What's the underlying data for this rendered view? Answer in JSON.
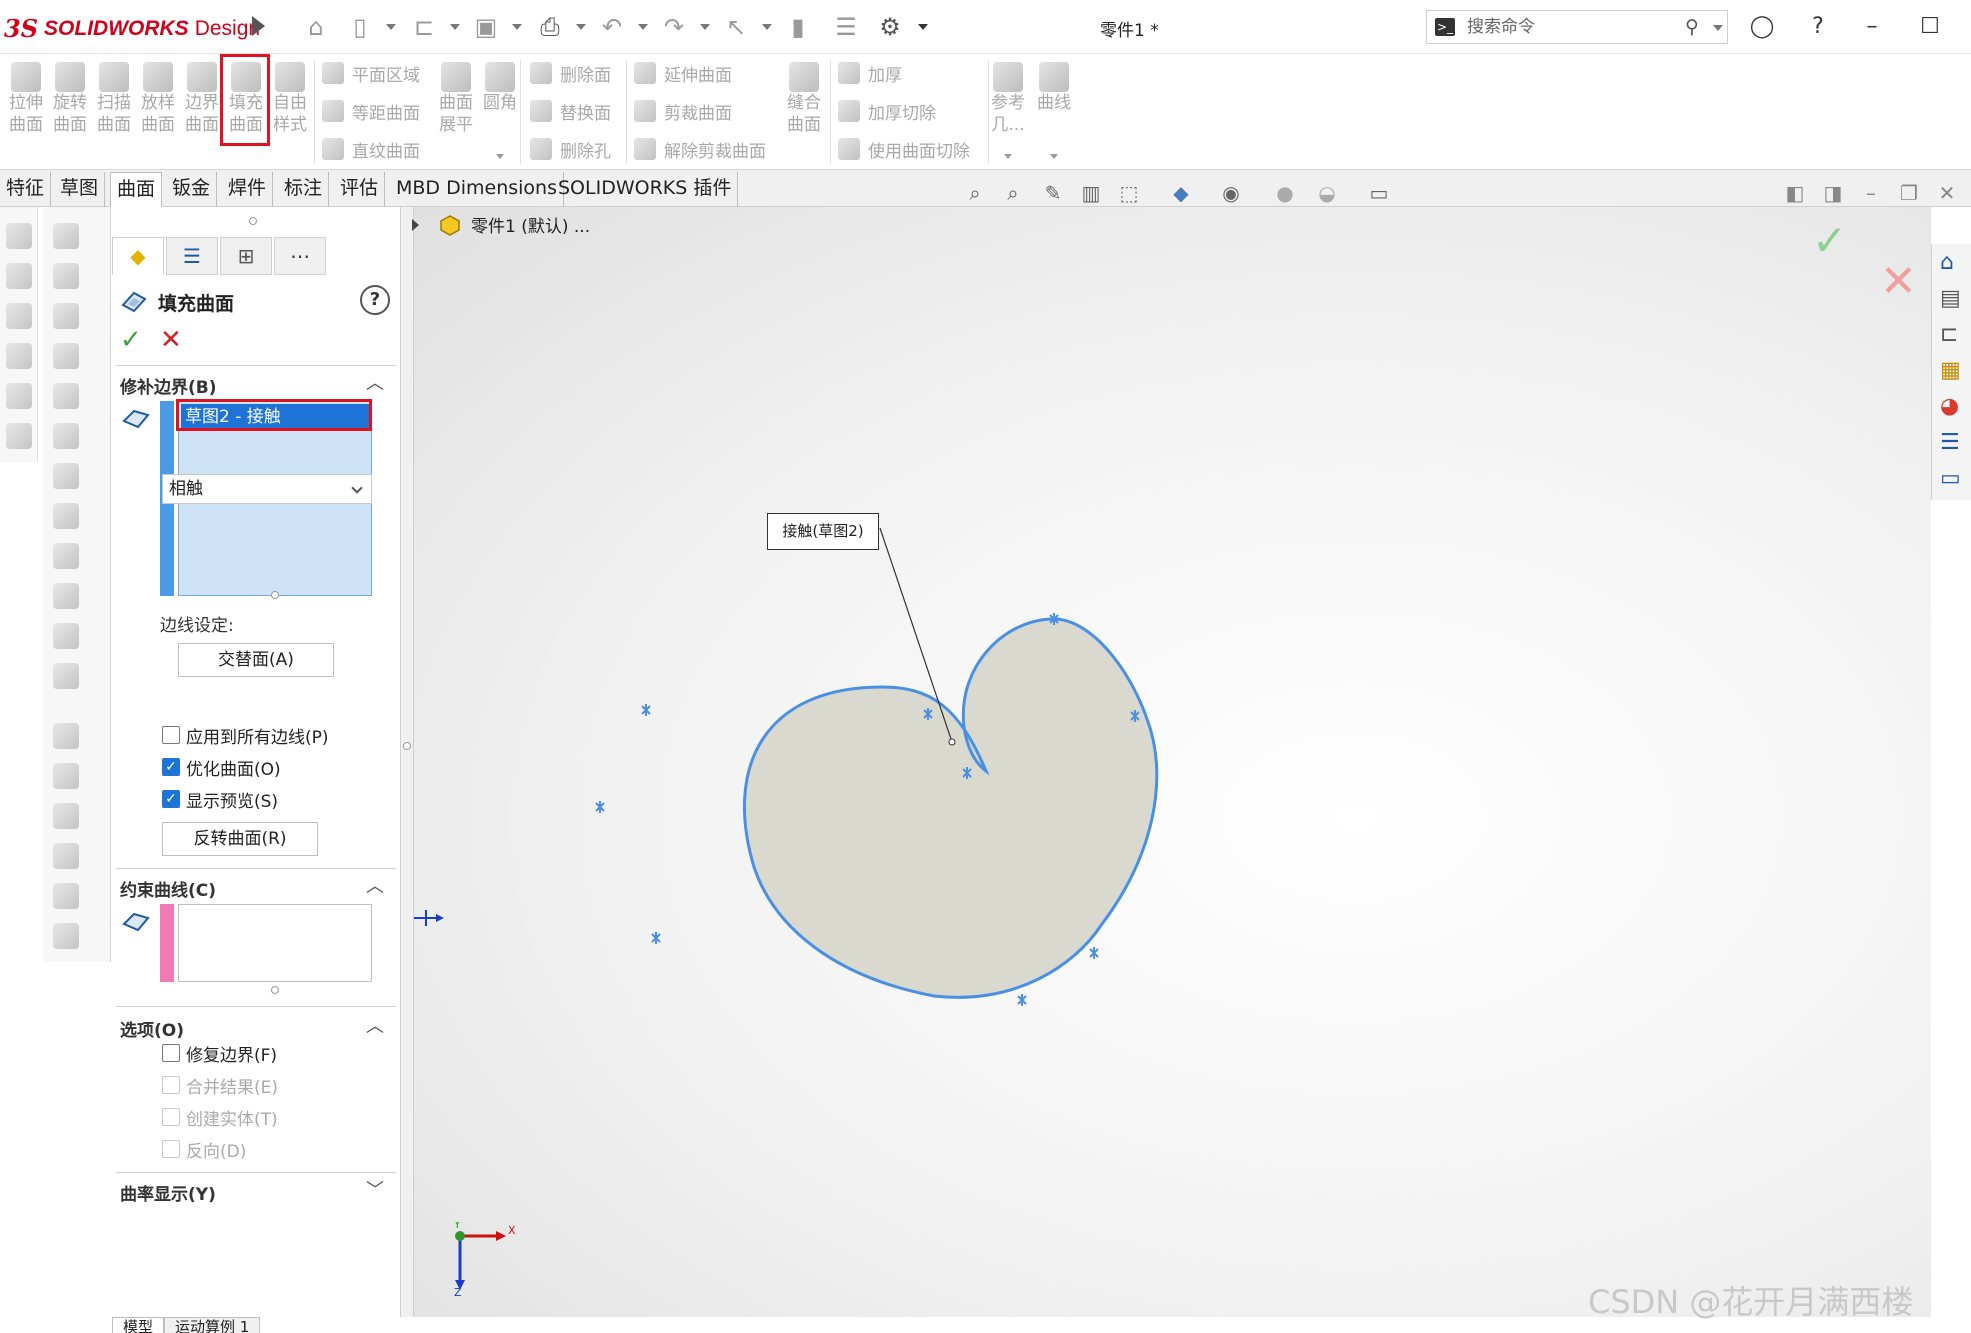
{
  "app": {
    "logo_mark": "3S",
    "logo_name": "SOLIDWORKS",
    "logo_sub": "Design",
    "document_title": "零件1 *",
    "search_placeholder": "搜索命令",
    "brand_color": "#d0021b"
  },
  "ribbon": {
    "big_buttons": [
      {
        "label": "拉伸\n曲面",
        "icon": "extruded-surface-icon"
      },
      {
        "label": "旋转\n曲面",
        "icon": "revolved-surface-icon"
      },
      {
        "label": "扫描\n曲面",
        "icon": "swept-surface-icon"
      },
      {
        "label": "放样\n曲面",
        "icon": "lofted-surface-icon"
      },
      {
        "label": "边界\n曲面",
        "icon": "boundary-surface-icon"
      },
      {
        "label": "填充\n曲面",
        "icon": "filled-surface-icon"
      },
      {
        "label": "自由\n样式",
        "icon": "freeform-icon"
      }
    ],
    "group2": [
      "平面区域",
      "等距曲面",
      "直纹曲面"
    ],
    "group2_big": [
      {
        "label": "曲面\n展平"
      },
      {
        "label": "圆角"
      }
    ],
    "group3": [
      "删除面",
      "替换面",
      "删除孔"
    ],
    "group4": [
      "延伸曲面",
      "剪裁曲面",
      "解除剪裁曲面"
    ],
    "group5_big": {
      "label": "缝合\n曲面"
    },
    "group6": [
      "加厚",
      "加厚切除",
      "使用曲面切除"
    ],
    "group7_big": [
      {
        "label": "参考\n几..."
      },
      {
        "label": "曲线"
      }
    ]
  },
  "tabs": [
    "特征",
    "草图",
    "曲面",
    "钣金",
    "焊件",
    "标注",
    "评估",
    "MBD Dimensions",
    "SOLIDWORKS 插件"
  ],
  "active_tab": "曲面",
  "breadcrumb": {
    "label": "零件1 (默认) ..."
  },
  "property_manager": {
    "title": "填充曲面",
    "help": "?",
    "sections": {
      "patch_boundary": {
        "title": "修补边界(B)",
        "selected_item": "草图2 - 接触",
        "edge_settings_label": "边线设定:",
        "alternate_face_button": "交替面(A)",
        "condition_value": "相触",
        "checkboxes": [
          {
            "label": "应用到所有边线(P)",
            "checked": false
          },
          {
            "label": "优化曲面(O)",
            "checked": true
          },
          {
            "label": "显示预览(S)",
            "checked": true
          }
        ],
        "reverse_surface_button": "反转曲面(R)"
      },
      "constraint_curves": {
        "title": "约束曲线(C)"
      },
      "options": {
        "title": "选项(O)",
        "checkboxes": [
          {
            "label": "修复边界(F)",
            "checked": false,
            "enabled": true
          },
          {
            "label": "合并结果(E)",
            "checked": false,
            "enabled": false
          },
          {
            "label": "创建实体(T)",
            "checked": false,
            "enabled": false
          },
          {
            "label": "反向(D)",
            "checked": false,
            "enabled": false
          }
        ]
      },
      "curvature_display": {
        "title": "曲率显示(Y)"
      }
    }
  },
  "viewport": {
    "callout_text": "接触(草图2)",
    "triad": {
      "x": "X",
      "y": "Y",
      "z": "Z"
    },
    "surface_color": "#d9d9d0",
    "edge_color": "#4a90e2"
  },
  "bottom_tabs": [
    "模型",
    "运动算例 1"
  ],
  "watermark": "CSDN @花开月满西楼"
}
